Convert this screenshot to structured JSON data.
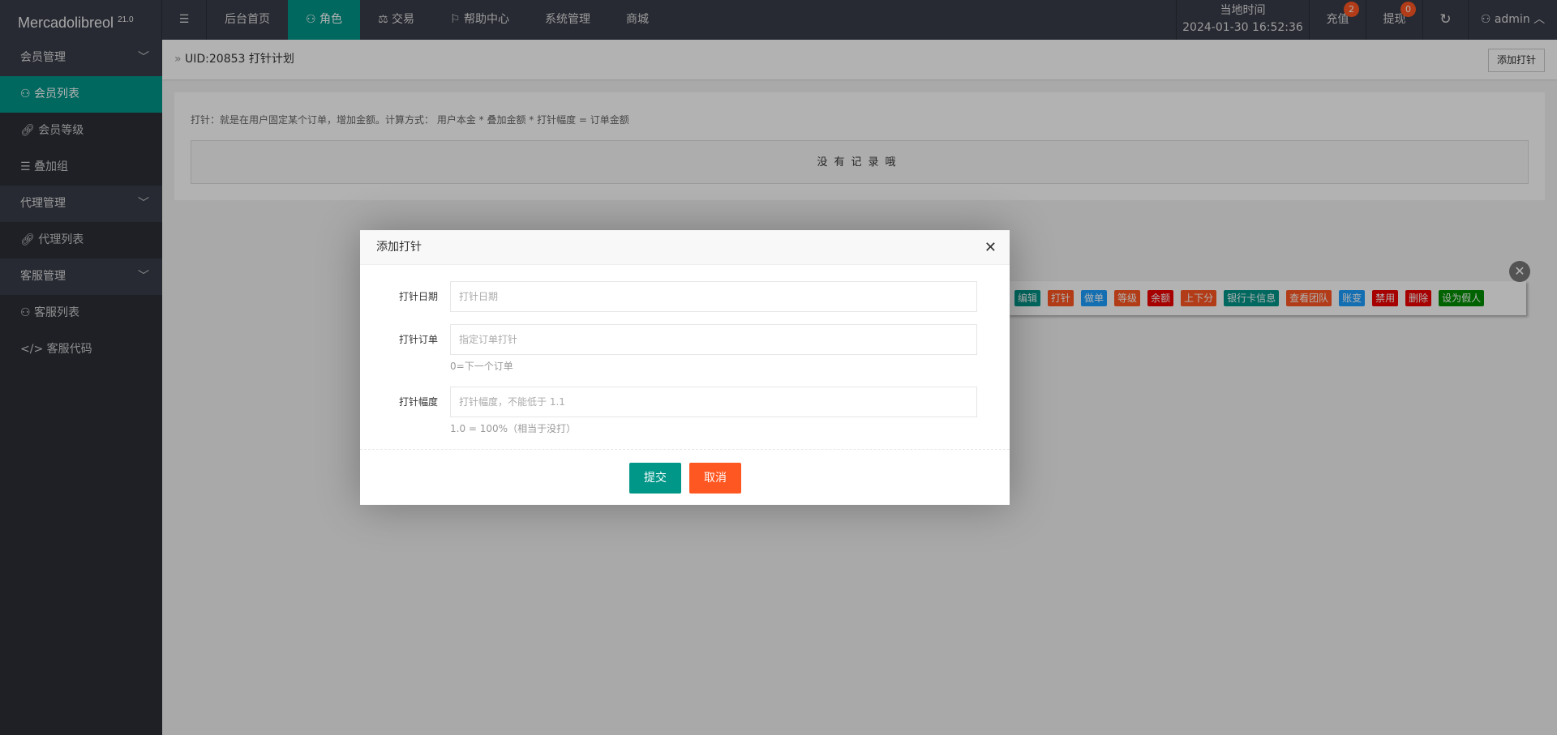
{
  "app": {
    "name": "Mercadolibreol",
    "version": "21.0"
  },
  "nav": [
    "后台首页",
    "角色",
    "交易",
    "帮助中心",
    "系统管理",
    "商城"
  ],
  "header": {
    "time_label": "当地时间",
    "time": "2024-01-30 16:52:36",
    "recharge": "充值",
    "recharge_count": "2",
    "withdraw": "提现",
    "withdraw_count": "0",
    "user": "admin"
  },
  "sidebar": [
    {
      "label": "会员管理",
      "type": "group"
    },
    {
      "label": "会员列表",
      "type": "item",
      "active": true
    },
    {
      "label": "会员等级",
      "type": "item"
    },
    {
      "label": "叠加组",
      "type": "item"
    },
    {
      "label": "代理管理",
      "type": "group"
    },
    {
      "label": "代理列表",
      "type": "item"
    },
    {
      "label": "客服管理",
      "type": "group"
    },
    {
      "label": "客服列表",
      "type": "item"
    },
    {
      "label": "客服代码",
      "type": "item"
    }
  ],
  "breadcrumb": "UID:20853 打针计划",
  "add_button": "添加打针",
  "description": "打针：就是在用户固定某个订单，增加金额。计算方式： 用户本金 * 叠加金额 * 打针幅度 = 订单金额",
  "empty_text": "没有记录哦",
  "actions": [
    {
      "label": "编辑",
      "color": "#009688"
    },
    {
      "label": "打针",
      "color": "#ff5722"
    },
    {
      "label": "做单",
      "color": "#1e9fff"
    },
    {
      "label": "等级",
      "color": "#ff5722"
    },
    {
      "label": "余额",
      "color": "#ee0000"
    },
    {
      "label": "上下分",
      "color": "#ff5722"
    },
    {
      "label": "银行卡信息",
      "color": "#009688"
    },
    {
      "label": "查看团队",
      "color": "#ff5722"
    },
    {
      "label": "账变",
      "color": "#1e9fff"
    },
    {
      "label": "禁用",
      "color": "#ee0000"
    },
    {
      "label": "删除",
      "color": "#ee0000"
    },
    {
      "label": "设为假人",
      "color": "#008f00"
    }
  ],
  "modal": {
    "title": "添加打针",
    "fields": [
      {
        "label": "打针日期",
        "placeholder": "打针日期",
        "help": ""
      },
      {
        "label": "打针订单",
        "placeholder": "指定订单打针",
        "help": "0=下一个订单"
      },
      {
        "label": "打针幅度",
        "placeholder": "打针幅度，不能低于 1.1",
        "help": "1.0 = 100%（相当于没打）"
      }
    ],
    "submit": "提交",
    "cancel": "取消"
  }
}
